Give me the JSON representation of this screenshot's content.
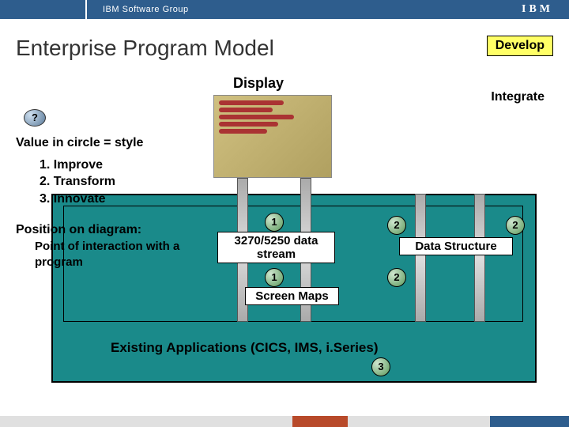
{
  "topbar": {
    "group": "IBM Software Group",
    "logo": "IBM"
  },
  "title": "Enterprise Program Model",
  "buttons": {
    "develop": "Develop",
    "integrate": "Integrate"
  },
  "display_label": "Display",
  "question_mark": "?",
  "legend": {
    "header": "Value in circle  = style",
    "items": [
      "1.  Improve",
      "2.  Transform",
      "3.  Innovate"
    ],
    "position_header": "Position on diagram:",
    "position_body": "Point of interaction with a program"
  },
  "diagram": {
    "data_stream_label": "3270/5250 data stream",
    "data_structure_label": "Data Structure",
    "screen_maps_label": "Screen Maps",
    "existing_apps_label": "Existing Applications  (CICS, IMS, i.Series)",
    "circle_top_left": "1",
    "circle_top_mid": "2",
    "circle_top_right": "2",
    "circle_bottom_left": "1",
    "circle_bottom_mid": "2",
    "circle_bottom_big": "3"
  }
}
